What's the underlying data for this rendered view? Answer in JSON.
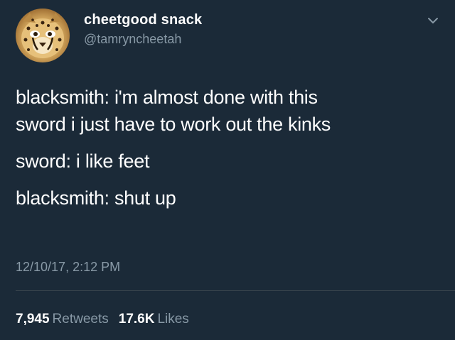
{
  "user": {
    "display_name": "cheetgood snack",
    "handle": "@tamryncheetah",
    "avatar_icon": "cheetah-avatar"
  },
  "menu_icon": "chevron-down-icon",
  "tweet": {
    "lines": [
      "blacksmith: i'm almost done with this",
      "sword i just have to work out the kinks",
      "sword: i like feet",
      "blacksmith: shut up"
    ]
  },
  "timestamp": "12/10/17, 2:12 PM",
  "stats": {
    "retweets_count": "7,945",
    "retweets_label": "Retweets",
    "likes_count": "17.6K",
    "likes_label": "Likes"
  },
  "colors": {
    "background": "#1b2a38",
    "text": "#ffffff",
    "secondary": "#8899a6",
    "divider": "#38444d"
  }
}
